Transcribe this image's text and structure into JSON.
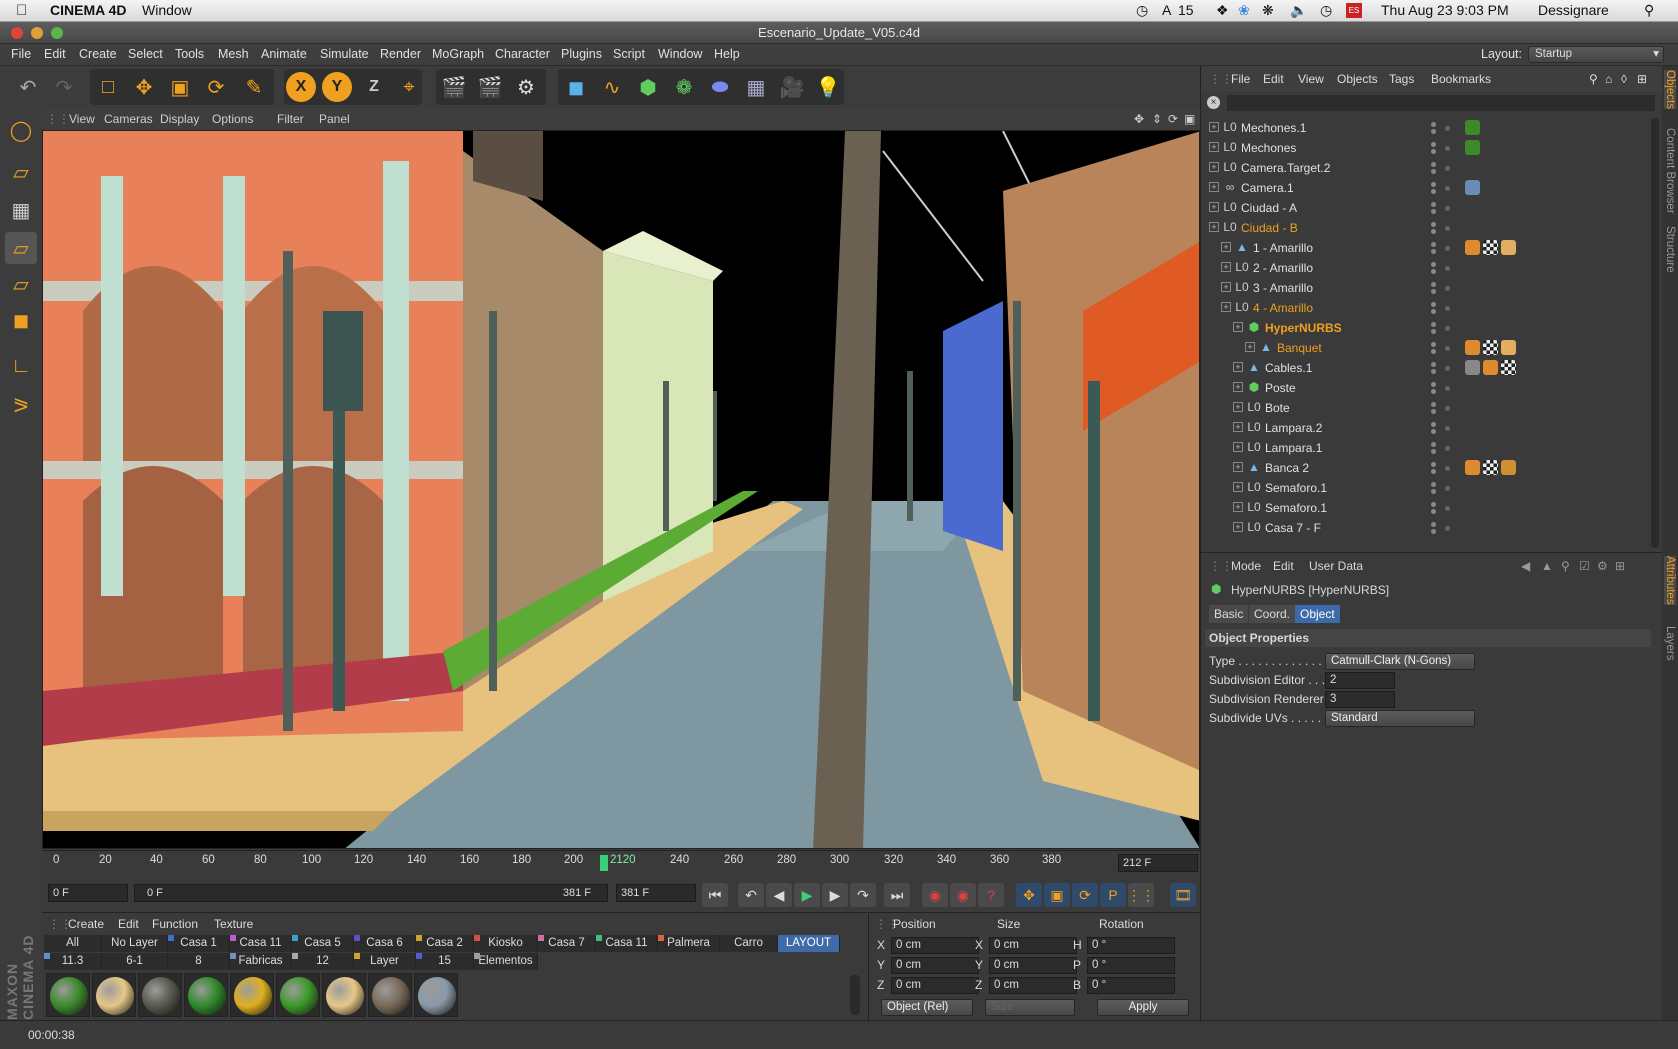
{
  "mac_menubar": {
    "apple": "",
    "app_name": "CINEMA 4D",
    "window_menu": "Window",
    "status_items": [
      "15"
    ],
    "clock": "Thu Aug 23  9:03 PM",
    "user": "Dessignare"
  },
  "window": {
    "title": "Escenario_Update_V05.c4d"
  },
  "app_menu": {
    "items": [
      "File",
      "Edit",
      "Create",
      "Select",
      "Tools",
      "Mesh",
      "Animate",
      "Simulate",
      "Render",
      "MoGraph",
      "Character",
      "Plugins",
      "Script",
      "Window",
      "Help"
    ],
    "layout_label": "Layout:",
    "layout_value": "Startup"
  },
  "toolbar": {
    "axis_x": "X",
    "axis_y": "Y",
    "axis_z": "Z"
  },
  "viewport": {
    "menu": [
      "View",
      "Cameras",
      "Display",
      "Options",
      "Filter",
      "Panel"
    ]
  },
  "timeline": {
    "ticks": [
      "0",
      "20",
      "40",
      "60",
      "80",
      "100",
      "120",
      "140",
      "160",
      "180",
      "200",
      "2120",
      "240",
      "260",
      "280",
      "300",
      "320",
      "340",
      "360",
      "380"
    ],
    "end_frame": "212 F",
    "current_frame": "0 F",
    "range_start": "0 F",
    "range_end": "381 F",
    "max_frame": "381 F",
    "playhead_frame": 212
  },
  "material_manager": {
    "menu": [
      "Create",
      "Edit",
      "Function",
      "Texture"
    ],
    "layer_row1": [
      {
        "label": "All",
        "color": ""
      },
      {
        "label": "No Layer",
        "color": ""
      },
      {
        "label": "Casa 1",
        "color": "#3a6fd0"
      },
      {
        "label": "Casa 11",
        "color": "#c05ad0"
      },
      {
        "label": "Casa 5",
        "color": "#3aa0d0"
      },
      {
        "label": "Casa 6",
        "color": "#5a50d0"
      },
      {
        "label": "Casa 2",
        "color": "#d0a030"
      },
      {
        "label": "Kiosko",
        "color": "#d05050"
      },
      {
        "label": "Casa 7",
        "color": "#d070a0"
      },
      {
        "label": "Casa 11",
        "color": "#40c080"
      },
      {
        "label": "Palmera",
        "color": "#e06040"
      },
      {
        "label": "Carro",
        "color": ""
      },
      {
        "label": "LAYOUT",
        "color": ""
      }
    ],
    "layer_row2": [
      {
        "label": "11.3",
        "color": "#6090d0"
      },
      {
        "label": "6-1",
        "color": ""
      },
      {
        "label": "8",
        "color": ""
      },
      {
        "label": "Fabricas",
        "color": "#7090c0"
      },
      {
        "label": "12",
        "color": "#aaaaaa"
      },
      {
        "label": "Layer",
        "color": "#d0a030"
      },
      {
        "label": "15",
        "color": "#5060d0"
      },
      {
        "label": "Elementos",
        "color": "#a0a0a0"
      }
    ],
    "materials": [
      {
        "icon": "material-green-leaf",
        "color": "#3c8a2a"
      },
      {
        "icon": "material-sand",
        "color": "#e6c888"
      },
      {
        "icon": "material-dark-stone",
        "color": "#5a5a50"
      },
      {
        "icon": "material-green",
        "color": "#2f8a2a"
      },
      {
        "icon": "material-yellow-stripes",
        "color": "#e0b020"
      },
      {
        "icon": "material-green-2",
        "color": "#3c9a2a"
      },
      {
        "icon": "material-sand-2",
        "color": "#e8c888"
      },
      {
        "icon": "material-mosaic",
        "color": "#7a6a58"
      },
      {
        "icon": "material-blue-gray",
        "color": "#8a9aa8"
      }
    ]
  },
  "coordinates": {
    "headers": [
      "Position",
      "Size",
      "Rotation"
    ],
    "rows": [
      {
        "p_label": "X",
        "p_value": "0 cm",
        "s_label": "X",
        "s_value": "0 cm",
        "r_label": "H",
        "r_value": "0 °"
      },
      {
        "p_label": "Y",
        "p_value": "0 cm",
        "s_label": "Y",
        "s_value": "0 cm",
        "r_label": "P",
        "r_value": "0 °"
      },
      {
        "p_label": "Z",
        "p_value": "0 cm",
        "s_label": "Z",
        "s_value": "0 cm",
        "r_label": "B",
        "r_value": "0 °"
      }
    ],
    "mode": "Object (Rel)",
    "size_mode": "Size",
    "apply": "Apply"
  },
  "status": {
    "time": "00:00:38"
  },
  "object_manager": {
    "menu": [
      "File",
      "Edit",
      "View",
      "Objects",
      "Tags",
      "Bookmarks"
    ],
    "rows": [
      {
        "name": "Mechones.1",
        "indent": 0,
        "icon": "null-icon",
        "highlight": false,
        "tags": [
          "tag-green"
        ]
      },
      {
        "name": "Mechones",
        "indent": 0,
        "icon": "null-icon",
        "highlight": false,
        "tags": [
          "tag-green"
        ]
      },
      {
        "name": "Camera.Target.2",
        "indent": 0,
        "icon": "null-icon",
        "highlight": false,
        "tags": []
      },
      {
        "name": "Camera.1",
        "indent": 0,
        "icon": "camera-icon",
        "highlight": false,
        "tags": [
          "tag-target"
        ]
      },
      {
        "name": "Ciudad - A",
        "indent": 0,
        "icon": "null-icon",
        "highlight": false,
        "tags": []
      },
      {
        "name": "Ciudad - B",
        "indent": 0,
        "icon": "null-icon",
        "highlight": true,
        "tags": []
      },
      {
        "name": "1 - Amarillo",
        "indent": 1,
        "icon": "polygon-icon",
        "highlight": false,
        "tags": [
          "tag-dots",
          "tag-checker",
          "tag-sand"
        ]
      },
      {
        "name": "2 - Amarillo",
        "indent": 1,
        "icon": "null-icon",
        "highlight": false,
        "tags": []
      },
      {
        "name": "3 - Amarillo",
        "indent": 1,
        "icon": "null-icon",
        "highlight": false,
        "tags": []
      },
      {
        "name": "4 - Amarillo",
        "indent": 1,
        "icon": "null-icon",
        "highlight": true,
        "tags": []
      },
      {
        "name": "HyperNURBS",
        "indent": 2,
        "icon": "hypernurbs-icon",
        "highlight": true,
        "tags": []
      },
      {
        "name": "Banquet",
        "indent": 3,
        "icon": "polygon-icon",
        "highlight": true,
        "tags": [
          "tag-dots",
          "tag-checker",
          "tag-sand"
        ]
      },
      {
        "name": "Cables.1",
        "indent": 2,
        "icon": "polygon-icon",
        "highlight": false,
        "tags": [
          "tag-gray",
          "tag-dots",
          "tag-checker"
        ]
      },
      {
        "name": "Poste",
        "indent": 2,
        "icon": "hypernurbs-icon",
        "highlight": false,
        "tags": []
      },
      {
        "name": "Bote",
        "indent": 2,
        "icon": "null-icon",
        "highlight": false,
        "tags": []
      },
      {
        "name": "Lampara.2",
        "indent": 2,
        "icon": "null-icon",
        "highlight": false,
        "tags": []
      },
      {
        "name": "Lampara.1",
        "indent": 2,
        "icon": "null-icon",
        "highlight": false,
        "tags": []
      },
      {
        "name": "Banca 2",
        "indent": 2,
        "icon": "polygon-icon",
        "highlight": false,
        "tags": [
          "tag-dots",
          "tag-checker",
          "tag-wood"
        ]
      },
      {
        "name": "Semaforo.1",
        "indent": 2,
        "icon": "null-icon",
        "highlight": false,
        "tags": []
      },
      {
        "name": "Semaforo.1",
        "indent": 2,
        "icon": "null-icon",
        "highlight": false,
        "tags": []
      },
      {
        "name": "Casa 7 - F",
        "indent": 2,
        "icon": "null-icon",
        "highlight": false,
        "tags": []
      }
    ]
  },
  "attributes": {
    "menu": [
      "Mode",
      "Edit",
      "User Data"
    ],
    "object_title": "HyperNURBS [HyperNURBS]",
    "tabs": [
      "Basic",
      "Coord.",
      "Object"
    ],
    "active_tab": "Object",
    "section": "Object Properties",
    "props": [
      {
        "label": "Type . . . . . . . . . . . . . . .",
        "value": "Catmull-Clark (N-Gons)",
        "kind": "dropdown"
      },
      {
        "label": "Subdivision Editor . . .",
        "value": "2",
        "kind": "number"
      },
      {
        "label": "Subdivision Renderer",
        "value": "3",
        "kind": "number"
      },
      {
        "label": "Subdivide UVs . . . . . .",
        "value": "Standard",
        "kind": "dropdown"
      }
    ]
  },
  "side_tabs": [
    "Objects",
    "Content Browser",
    "Structure",
    "Attributes",
    "Layers"
  ]
}
